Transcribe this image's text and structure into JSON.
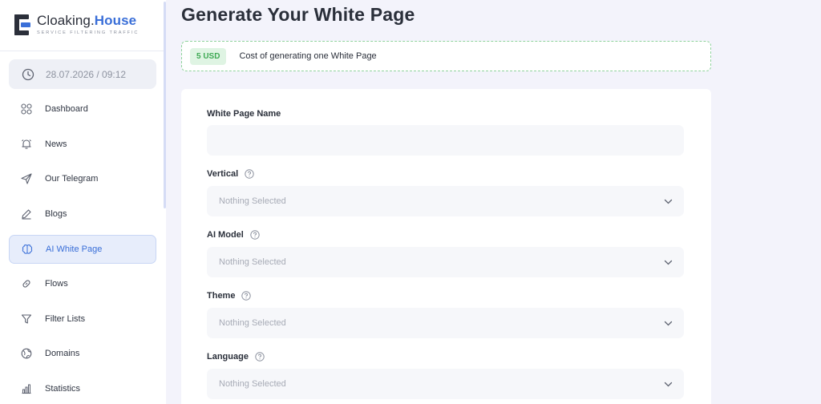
{
  "brand": {
    "name_part1": "Cloaking.",
    "name_part2": "House",
    "tagline": "SERVICE FILTERING TRAFFIC"
  },
  "sidebar": {
    "datetime": "28.07.2026 / 09:12",
    "items": [
      {
        "label": "Dashboard",
        "icon": "grid-icon"
      },
      {
        "label": "News",
        "icon": "bell-icon"
      },
      {
        "label": "Our Telegram",
        "icon": "send-icon"
      },
      {
        "label": "Blogs",
        "icon": "pen-icon"
      },
      {
        "label": "AI White Page",
        "icon": "brain-icon",
        "active": true
      },
      {
        "label": "Flows",
        "icon": "link-icon"
      },
      {
        "label": "Filter Lists",
        "icon": "filter-icon"
      },
      {
        "label": "Domains",
        "icon": "globe-icon"
      },
      {
        "label": "Statistics",
        "icon": "bar-chart-icon"
      }
    ]
  },
  "main": {
    "title": "Generate Your White Page",
    "cost": {
      "badge": "5 USD",
      "text": "Cost of generating one White Page"
    },
    "form": {
      "name_label": "White Page Name",
      "name_value": "",
      "vertical_label": "Vertical",
      "vertical_value": "Nothing Selected",
      "ai_model_label": "AI Model",
      "ai_model_value": "Nothing Selected",
      "theme_label": "Theme",
      "theme_value": "Nothing Selected",
      "language_label": "Language",
      "language_value": "Nothing Selected"
    }
  },
  "colors": {
    "accent": "#3a6fd8",
    "success": "#3faa55",
    "background": "#f3f3fb"
  }
}
